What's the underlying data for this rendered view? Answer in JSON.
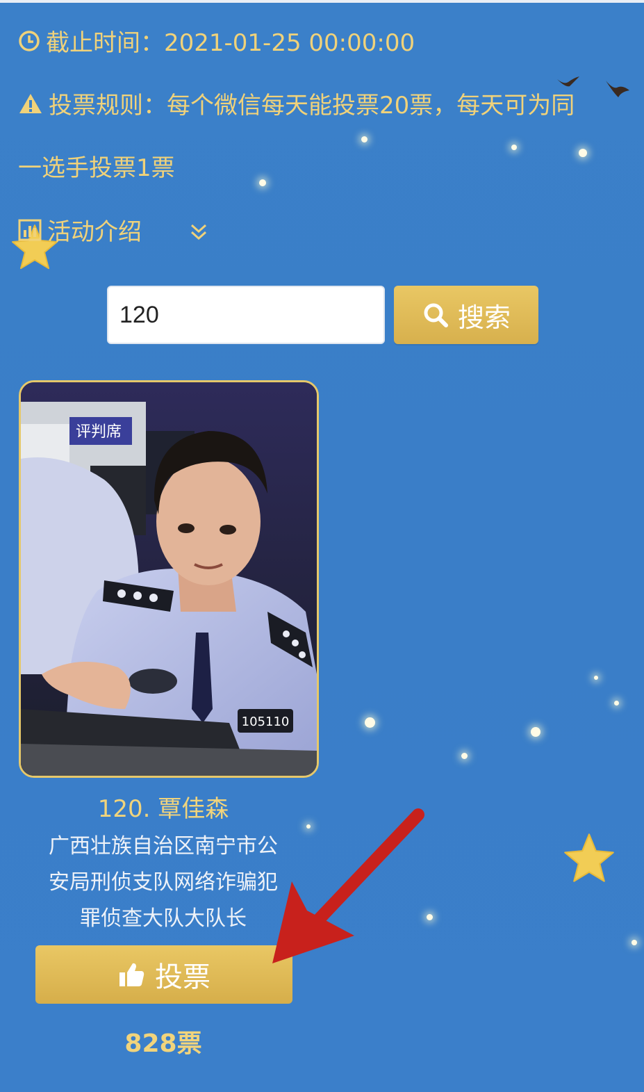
{
  "deadline": {
    "label": "截止时间：",
    "value": "2021-01-25 00:00:00"
  },
  "rules": {
    "line1": "投票规则：每个微信每天能投票20票，每天可为同",
    "line2": "一选手投票1票"
  },
  "intro": {
    "label": "活动介绍"
  },
  "search": {
    "value": "120",
    "button_label": "搜索"
  },
  "candidate": {
    "name": "120. 覃佳森",
    "desc_line1": "广西壮族自治区南宁市公",
    "desc_line2": "安局刑侦支队网络诈骗犯",
    "desc_line3": "罪侦查大队大队长",
    "vote_label": "投票",
    "votes": "828票",
    "photo_sign": "评判席",
    "badge_number": "105110"
  },
  "colors": {
    "background": "#3b80c9",
    "gold": "#e0bb57",
    "text_gold": "#f1d47c",
    "arrow_red": "#c8211c"
  },
  "icons": [
    "clock-icon",
    "warning-icon",
    "chart-icon",
    "chevron-down-icon",
    "search-icon",
    "thumbs-up-icon",
    "star-icon",
    "bird-icon",
    "arrow-annotation"
  ]
}
